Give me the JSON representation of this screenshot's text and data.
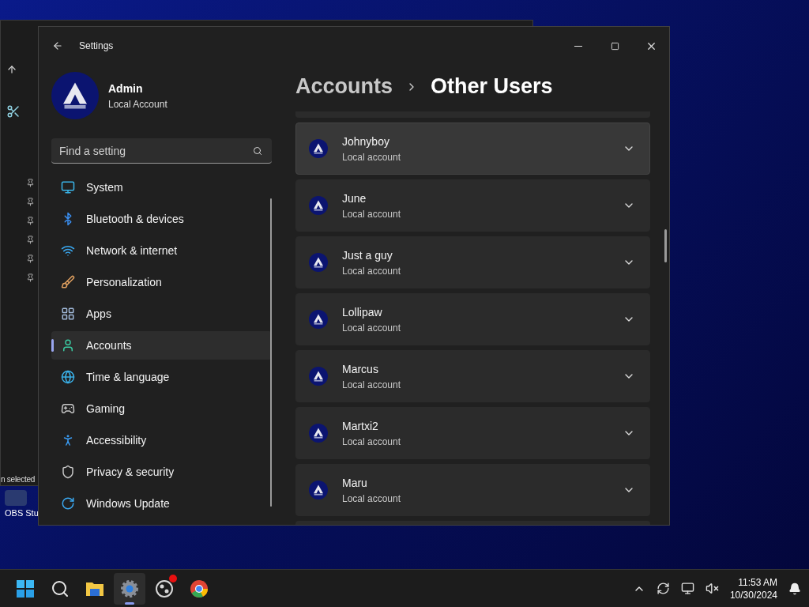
{
  "background_window": {
    "status_text": "n selected"
  },
  "desktop_icons": [
    {
      "label": "OBS Stu"
    }
  ],
  "window": {
    "title": "Settings"
  },
  "profile": {
    "name": "Admin",
    "account_type": "Local Account"
  },
  "search": {
    "placeholder": "Find a setting"
  },
  "nav": [
    {
      "label": "System",
      "selected": false
    },
    {
      "label": "Bluetooth & devices",
      "selected": false
    },
    {
      "label": "Network & internet",
      "selected": false
    },
    {
      "label": "Personalization",
      "selected": false
    },
    {
      "label": "Apps",
      "selected": false
    },
    {
      "label": "Accounts",
      "selected": true
    },
    {
      "label": "Time & language",
      "selected": false
    },
    {
      "label": "Gaming",
      "selected": false
    },
    {
      "label": "Accessibility",
      "selected": false
    },
    {
      "label": "Privacy & security",
      "selected": false
    },
    {
      "label": "Windows Update",
      "selected": false
    }
  ],
  "breadcrumb": {
    "parent": "Accounts",
    "current": "Other Users"
  },
  "users": [
    {
      "name": "Johnyboy",
      "subtitle": "Local account",
      "hovered": true
    },
    {
      "name": "June",
      "subtitle": "Local account",
      "hovered": false
    },
    {
      "name": "Just a guy",
      "subtitle": "Local account",
      "hovered": false
    },
    {
      "name": "Lollipaw",
      "subtitle": "Local account",
      "hovered": false
    },
    {
      "name": "Marcus",
      "subtitle": "Local account",
      "hovered": false
    },
    {
      "name": "Martxi2",
      "subtitle": "Local account",
      "hovered": false
    },
    {
      "name": "Maru",
      "subtitle": "Local account",
      "hovered": false
    }
  ],
  "taskbar": {
    "apps": [
      {
        "selected": false,
        "badge": false
      },
      {
        "selected": false,
        "badge": false
      },
      {
        "selected": false,
        "badge": false
      },
      {
        "selected": true,
        "badge": false
      },
      {
        "selected": false,
        "badge": true
      },
      {
        "selected": false,
        "badge": false
      }
    ],
    "time": "11:53 AM",
    "date": "10/30/2024"
  }
}
